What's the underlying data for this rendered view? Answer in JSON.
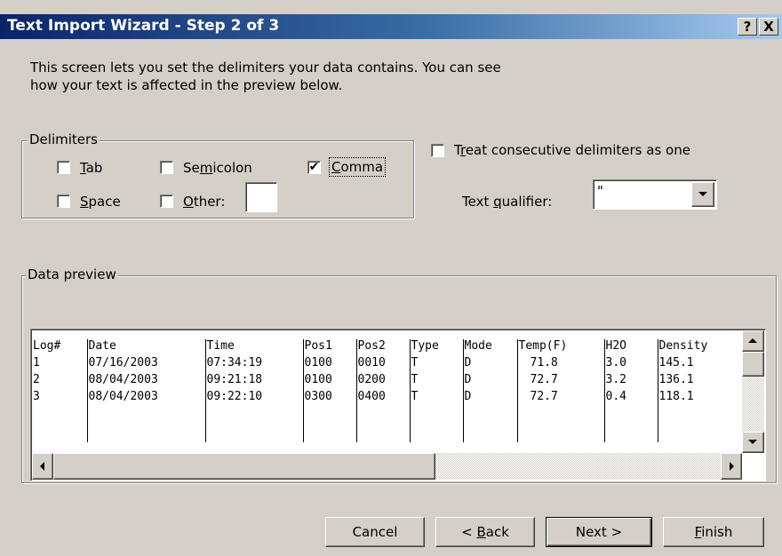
{
  "window": {
    "title": "Text Import Wizard - Step 2 of 3",
    "help_button": "?",
    "close_button": "X",
    "title_gradient": [
      "#0a246a",
      "#a6caf0"
    ]
  },
  "intro": {
    "line1": "This screen lets you set the delimiters your data contains.  You can see",
    "line2": "how your text is affected in the preview below."
  },
  "delimiters": {
    "legend": "Delimiters",
    "tab": {
      "pre": "",
      "accel": "T",
      "post": "ab",
      "checked": false
    },
    "semicolon": {
      "pre": "Se",
      "accel": "m",
      "post": "icolon",
      "checked": false
    },
    "comma": {
      "pre": "",
      "accel": "C",
      "post": "omma",
      "checked": true
    },
    "space": {
      "pre": "",
      "accel": "S",
      "post": "pace",
      "checked": false
    },
    "other": {
      "pre": "",
      "accel": "O",
      "post": "ther:",
      "checked": false,
      "value": ""
    }
  },
  "consecutive": {
    "pre": "T",
    "accel": "r",
    "post": "eat consecutive delimiters as one",
    "checked": false
  },
  "qualifier": {
    "pre": "Text ",
    "accel": "q",
    "post": "ualifier:",
    "value": "\""
  },
  "preview": {
    "legend": "Data preview",
    "columns": [
      "Log#",
      "Date",
      "Time",
      "Pos1",
      "Pos2",
      "Type",
      "Mode",
      "Temp(F)",
      "H2O",
      "Density"
    ],
    "rows": [
      [
        "1",
        "07/16/2003",
        "07:34:19",
        "0100",
        "0010",
        "T",
        "D",
        "71.8",
        "3.0",
        "145.1"
      ],
      [
        "2",
        "08/04/2003",
        "09:21:18",
        "0100",
        "0200",
        "T",
        "D",
        "72.7",
        "3.2",
        "136.1"
      ],
      [
        "3",
        "08/04/2003",
        "09:22:10",
        "0300",
        "0400",
        "T",
        "D",
        "72.7",
        "0.4",
        "118.1"
      ]
    ]
  },
  "buttons": {
    "cancel": "Cancel",
    "back": {
      "pre": "< ",
      "accel": "B",
      "post": "ack"
    },
    "next": "Next >",
    "finish": {
      "pre": "",
      "accel": "F",
      "post": "inish"
    }
  }
}
